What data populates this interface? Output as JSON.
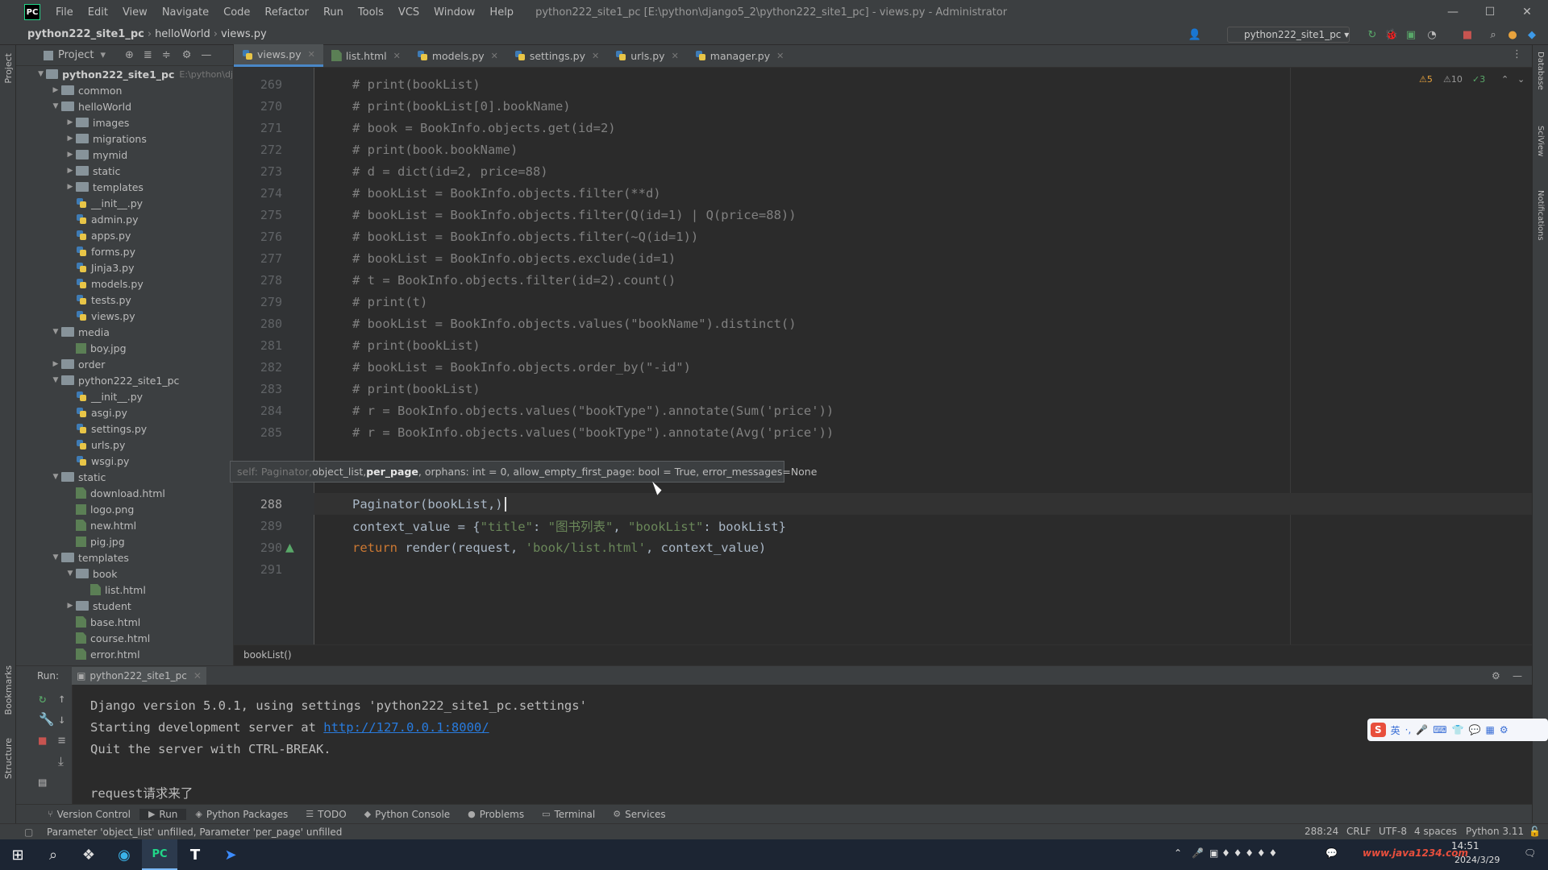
{
  "titlebar": {
    "logo": "PC",
    "menu": [
      "File",
      "Edit",
      "View",
      "Navigate",
      "Code",
      "Refactor",
      "Run",
      "Tools",
      "VCS",
      "Window",
      "Help"
    ],
    "title": "python222_site1_pc [E:\\python\\django5_2\\python222_site1_pc] - views.py - Administrator"
  },
  "navbar": {
    "crumbs": [
      "python222_site1_pc",
      "helloWorld",
      "views.py"
    ],
    "run_config": "python222_site1_pc"
  },
  "project": {
    "header": "Project",
    "root": "python222_site1_pc",
    "root_path": "E:\\python\\dj",
    "tree": [
      {
        "depth": 1,
        "type": "folder",
        "label": "common",
        "open": false
      },
      {
        "depth": 1,
        "type": "folder",
        "label": "helloWorld",
        "open": true
      },
      {
        "depth": 2,
        "type": "folder",
        "label": "images",
        "open": false
      },
      {
        "depth": 2,
        "type": "folder",
        "label": "migrations",
        "open": false
      },
      {
        "depth": 2,
        "type": "folder",
        "label": "mymid",
        "open": false
      },
      {
        "depth": 2,
        "type": "folder",
        "label": "static",
        "open": false
      },
      {
        "depth": 2,
        "type": "folder",
        "label": "templates",
        "open": false
      },
      {
        "depth": 2,
        "type": "py",
        "label": "__init__.py"
      },
      {
        "depth": 2,
        "type": "py",
        "label": "admin.py"
      },
      {
        "depth": 2,
        "type": "py",
        "label": "apps.py"
      },
      {
        "depth": 2,
        "type": "py",
        "label": "forms.py"
      },
      {
        "depth": 2,
        "type": "py",
        "label": "Jinja3.py"
      },
      {
        "depth": 2,
        "type": "py",
        "label": "models.py"
      },
      {
        "depth": 2,
        "type": "py",
        "label": "tests.py"
      },
      {
        "depth": 2,
        "type": "py",
        "label": "views.py"
      },
      {
        "depth": 1,
        "type": "folder",
        "label": "media",
        "open": true
      },
      {
        "depth": 2,
        "type": "img",
        "label": "boy.jpg"
      },
      {
        "depth": 1,
        "type": "folder",
        "label": "order",
        "open": false
      },
      {
        "depth": 1,
        "type": "folder",
        "label": "python222_site1_pc",
        "open": true
      },
      {
        "depth": 2,
        "type": "py",
        "label": "__init__.py"
      },
      {
        "depth": 2,
        "type": "py",
        "label": "asgi.py"
      },
      {
        "depth": 2,
        "type": "py",
        "label": "settings.py"
      },
      {
        "depth": 2,
        "type": "py",
        "label": "urls.py"
      },
      {
        "depth": 2,
        "type": "py",
        "label": "wsgi.py"
      },
      {
        "depth": 1,
        "type": "folder",
        "label": "static",
        "open": true
      },
      {
        "depth": 2,
        "type": "html",
        "label": "download.html"
      },
      {
        "depth": 2,
        "type": "img",
        "label": "logo.png"
      },
      {
        "depth": 2,
        "type": "html",
        "label": "new.html"
      },
      {
        "depth": 2,
        "type": "img",
        "label": "pig.jpg"
      },
      {
        "depth": 1,
        "type": "folder",
        "label": "templates",
        "open": true
      },
      {
        "depth": 2,
        "type": "folder",
        "label": "book",
        "open": true
      },
      {
        "depth": 3,
        "type": "html",
        "label": "list.html"
      },
      {
        "depth": 2,
        "type": "folder",
        "label": "student",
        "open": false
      },
      {
        "depth": 2,
        "type": "html",
        "label": "base.html"
      },
      {
        "depth": 2,
        "type": "html",
        "label": "course.html"
      },
      {
        "depth": 2,
        "type": "html",
        "label": "error.html"
      }
    ]
  },
  "tabs": [
    "views.py",
    "list.html",
    "models.py",
    "settings.py",
    "urls.py",
    "manager.py"
  ],
  "editor": {
    "inspections": {
      "warnings": "5",
      "weak": "10",
      "typos": "3"
    },
    "lines": [
      {
        "n": "269",
        "kind": "cmt",
        "text": "# print(bookList)"
      },
      {
        "n": "270",
        "kind": "cmt",
        "text": "# print(bookList[0].bookName)"
      },
      {
        "n": "271",
        "kind": "cmt",
        "text": "# book = BookInfo.objects.get(id=2)"
      },
      {
        "n": "272",
        "kind": "cmt",
        "text": "# print(book.bookName)"
      },
      {
        "n": "273",
        "kind": "cmt",
        "text": "# d = dict(id=2, price=88)"
      },
      {
        "n": "274",
        "kind": "cmt",
        "text": "# bookList = BookInfo.objects.filter(**d)"
      },
      {
        "n": "275",
        "kind": "cmt",
        "text": "# bookList = BookInfo.objects.filter(Q(id=1) | Q(price=88))"
      },
      {
        "n": "276",
        "kind": "cmt",
        "text": "# bookList = BookInfo.objects.filter(~Q(id=1))"
      },
      {
        "n": "277",
        "kind": "cmt",
        "text": "# bookList = BookInfo.objects.exclude(id=1)"
      },
      {
        "n": "278",
        "kind": "cmt",
        "text": "# t = BookInfo.objects.filter(id=2).count()"
      },
      {
        "n": "279",
        "kind": "cmt",
        "text": "# print(t)"
      },
      {
        "n": "280",
        "kind": "cmt",
        "text": "# bookList = BookInfo.objects.values(\"bookName\").distinct()"
      },
      {
        "n": "281",
        "kind": "cmt",
        "text": "# print(bookList)"
      },
      {
        "n": "282",
        "kind": "cmt",
        "text": "# bookList = BookInfo.objects.order_by(\"-id\")"
      },
      {
        "n": "283",
        "kind": "cmt",
        "text": "# print(bookList)"
      },
      {
        "n": "284",
        "kind": "cmt",
        "text": "# r = BookInfo.objects.values(\"bookType\").annotate(Sum('price'))"
      },
      {
        "n": "285",
        "kind": "cmt",
        "text": "# r = BookInfo.objects.values(\"bookType\").annotate(Avg('price'))"
      }
    ],
    "line_288": {
      "n": "288",
      "text": "Paginator(bookList,)"
    },
    "line_289": {
      "n": "289",
      "pre": "context_value = {",
      "s1": "\"title\"",
      "mid1": ": ",
      "s2": "\"图书列表\"",
      "mid2": ", ",
      "s3": "\"bookList\"",
      "post": ": bookList}"
    },
    "line_290": {
      "n": "290",
      "kw": "return",
      "pre": " render(request, ",
      "s1": "'book/list.html'",
      "post": ", context_value)"
    },
    "line_291": {
      "n": "291"
    },
    "hint": {
      "dim1": "self: Paginator, ",
      "p1": "object_list, ",
      "bold": "per_page",
      "rest": ", orphans: int = 0, allow_empty_first_page: bool = True, error_messages=None"
    },
    "breadcrumb": "bookList()"
  },
  "run": {
    "label": "Run:",
    "tab": "python222_site1_pc",
    "output": [
      "Django version 5.0.1, using settings 'python222_site1_pc.settings'",
      "Quit the server with CTRL-BREAK.",
      "request请求来了"
    ],
    "server_prefix": "Starting development server at ",
    "server_url": "http://127.0.0.1:8000/"
  },
  "bottom_tabs": [
    "Version Control",
    "Run",
    "Python Packages",
    "TODO",
    "Python Console",
    "Problems",
    "Terminal",
    "Services"
  ],
  "status": {
    "message": "Parameter 'object_list' unfilled, Parameter 'per_page' unfilled",
    "position": "288:24",
    "line_sep": "CRLF",
    "encoding": "UTF-8",
    "indent": "4 spaces",
    "interpreter": "Python 3.11"
  },
  "side": {
    "left_labels": [
      "Project",
      "Bookmarks",
      "Structure"
    ],
    "right_labels": [
      "Database",
      "SciView",
      "Notifications"
    ]
  },
  "taskbar": {
    "date": "2024/3/29",
    "time": "14:51",
    "watermark": "www.java1234.com"
  },
  "ime": {
    "items": [
      "S",
      "英",
      "·,",
      "🎤",
      "⌨",
      "👕",
      "💬",
      "▦",
      "⚙"
    ]
  }
}
